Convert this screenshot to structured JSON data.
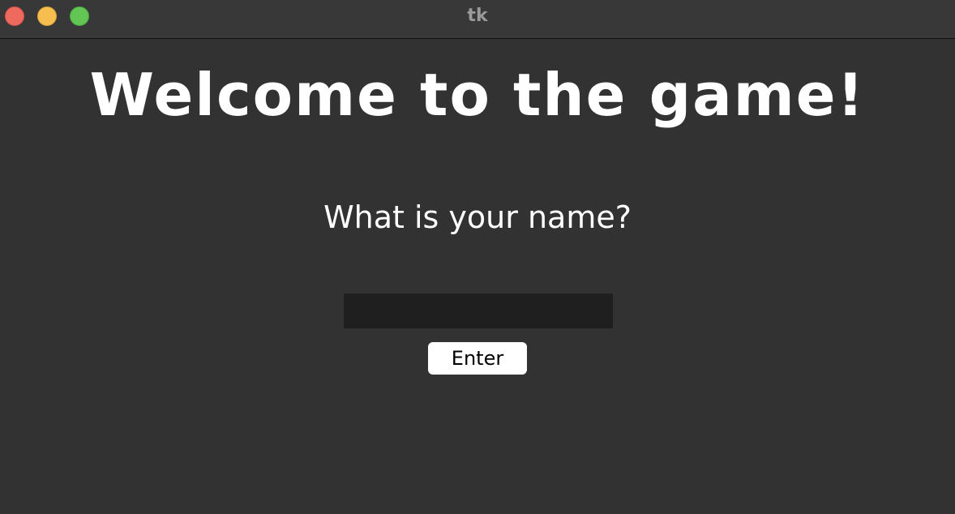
{
  "window": {
    "title": "tk",
    "controls": {
      "close": "close-icon",
      "minimize": "minimize-icon",
      "zoom": "zoom-icon"
    },
    "colors": {
      "background": "#323232",
      "titlebar": "#383838",
      "close": "#ee6a5f",
      "minimize": "#f5be4f",
      "zoom": "#62c554"
    }
  },
  "main": {
    "heading": "Welcome to the game!",
    "prompt": "What is your name?",
    "name_input": {
      "value": "",
      "placeholder": ""
    },
    "enter_label": "Enter"
  }
}
